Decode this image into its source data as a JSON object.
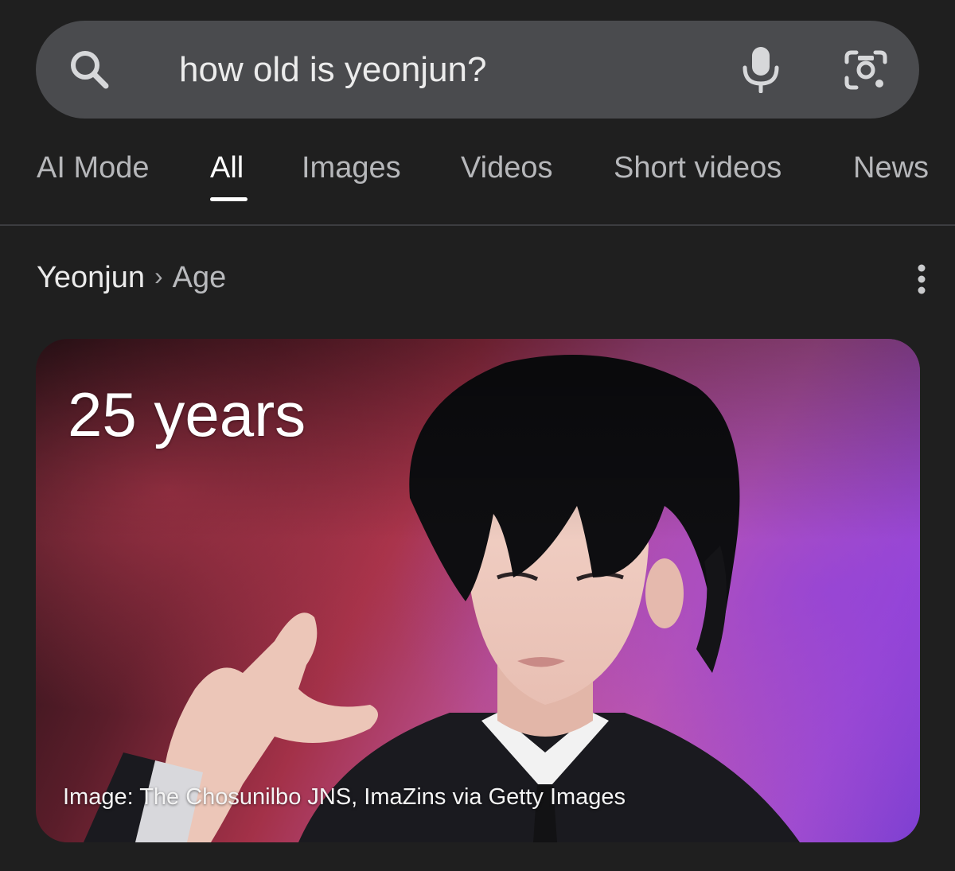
{
  "search": {
    "query": "how old is yeonjun?",
    "icons": {
      "search": "search-icon",
      "voice": "microphone-icon",
      "lens": "google-lens-icon"
    }
  },
  "tabs": [
    {
      "label": "AI Mode",
      "active": false
    },
    {
      "label": "All",
      "active": true
    },
    {
      "label": "Images",
      "active": false
    },
    {
      "label": "Videos",
      "active": false
    },
    {
      "label": "Short videos",
      "active": false
    },
    {
      "label": "News",
      "active": false
    }
  ],
  "breadcrumb": {
    "entity": "Yeonjun",
    "separator": "›",
    "attribute": "Age",
    "more_icon": "more-vertical-icon"
  },
  "answer_card": {
    "value": "25 years",
    "image_credit": "Image: The Chosunilbo JNS, ImaZins via Getty Images"
  },
  "colors": {
    "background": "#1f1f1f",
    "search_bar": "#4a4b4e",
    "text_primary": "#ffffff",
    "text_secondary": "#b6b7ba",
    "accent_pink": "#c45aa8",
    "accent_purple": "#7d3fd2"
  }
}
